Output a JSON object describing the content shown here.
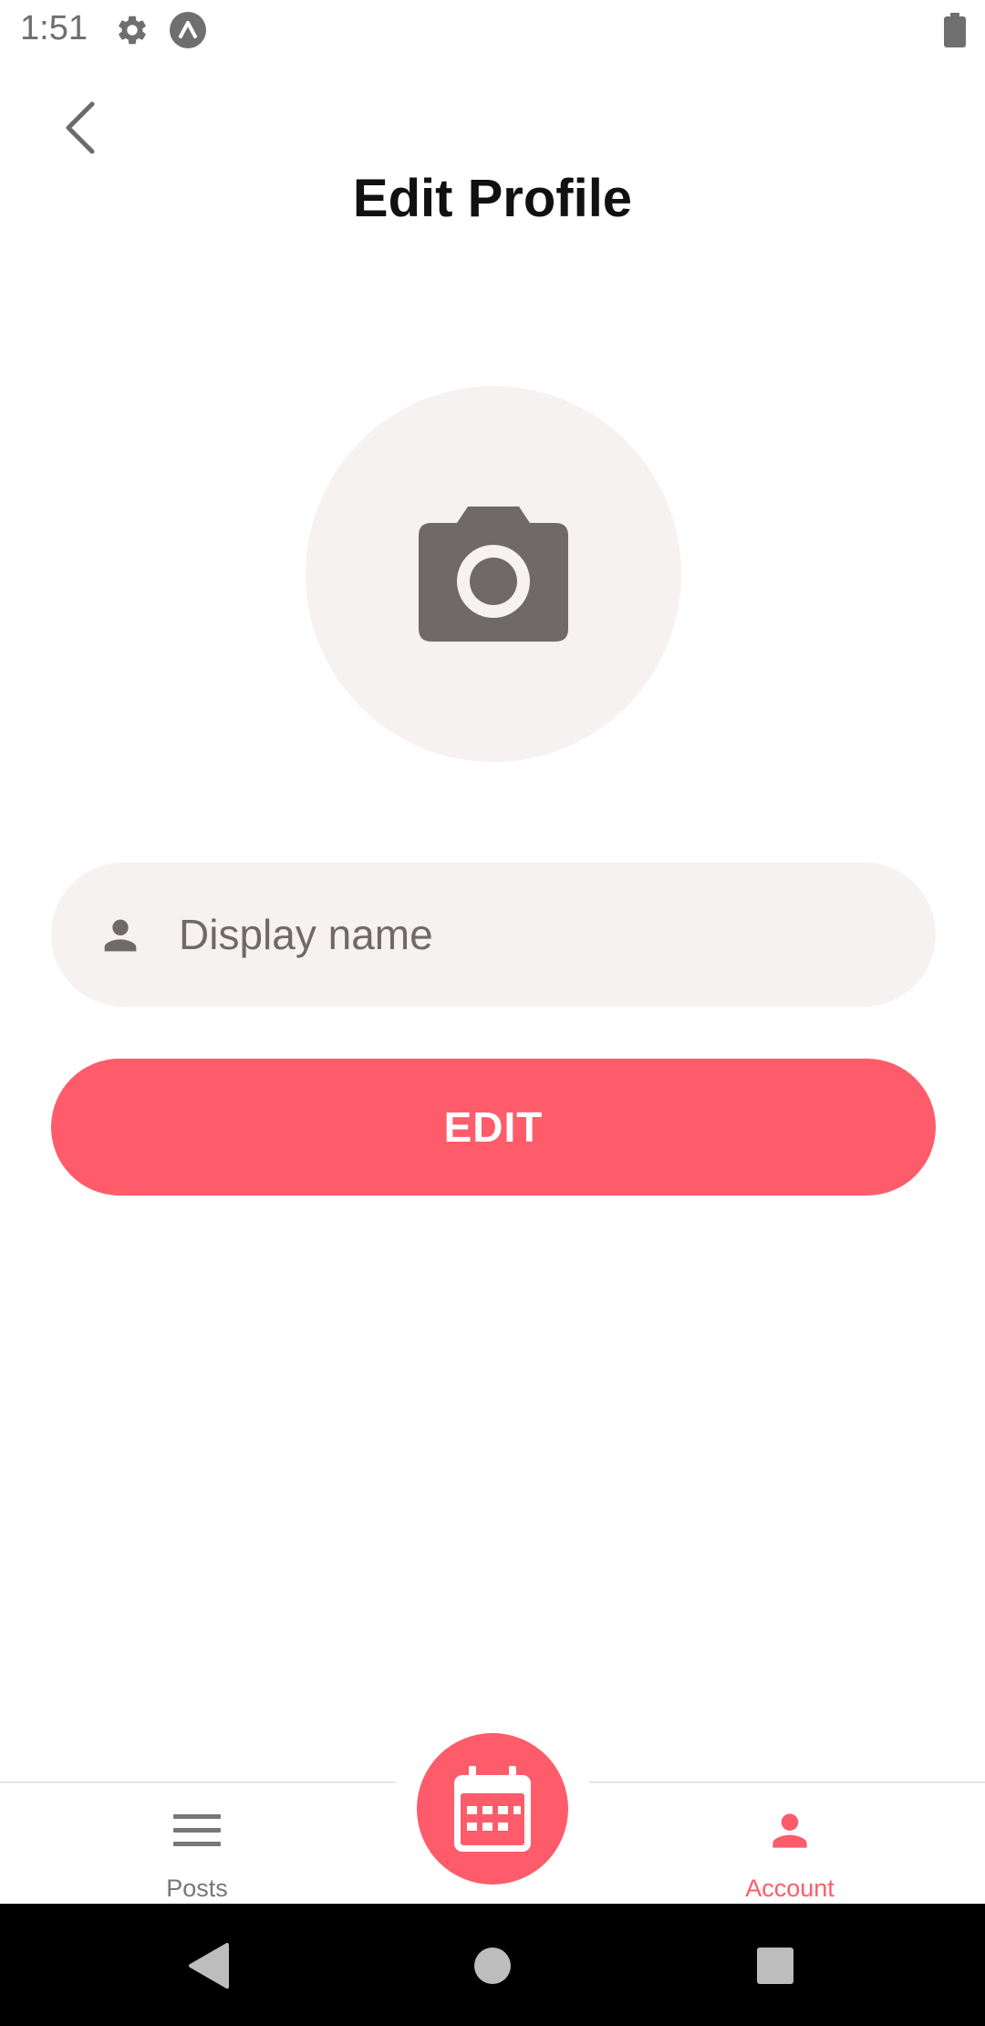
{
  "status_bar": {
    "time": "1:51",
    "icons": [
      "settings-gear-icon",
      "expo-a-icon",
      "battery-icon"
    ]
  },
  "header": {
    "title": "Edit Profile",
    "back_icon": "chevron-left-icon"
  },
  "avatar": {
    "icon": "camera-icon"
  },
  "form": {
    "display_name": {
      "value": "",
      "placeholder": "Display name",
      "icon": "person-icon"
    },
    "edit_label": "EDIT"
  },
  "tab_bar": {
    "tabs": [
      {
        "label": "Posts",
        "icon": "menu-lines-icon",
        "active": false
      },
      {
        "label": "Account",
        "icon": "person-icon",
        "active": true
      }
    ],
    "fab_icon": "calendar-icon"
  },
  "colors": {
    "accent": "#fe5c6a",
    "field_background": "#f6f2f1",
    "icon_gray": "#6f6a69",
    "inactive_tab": "#777777"
  }
}
